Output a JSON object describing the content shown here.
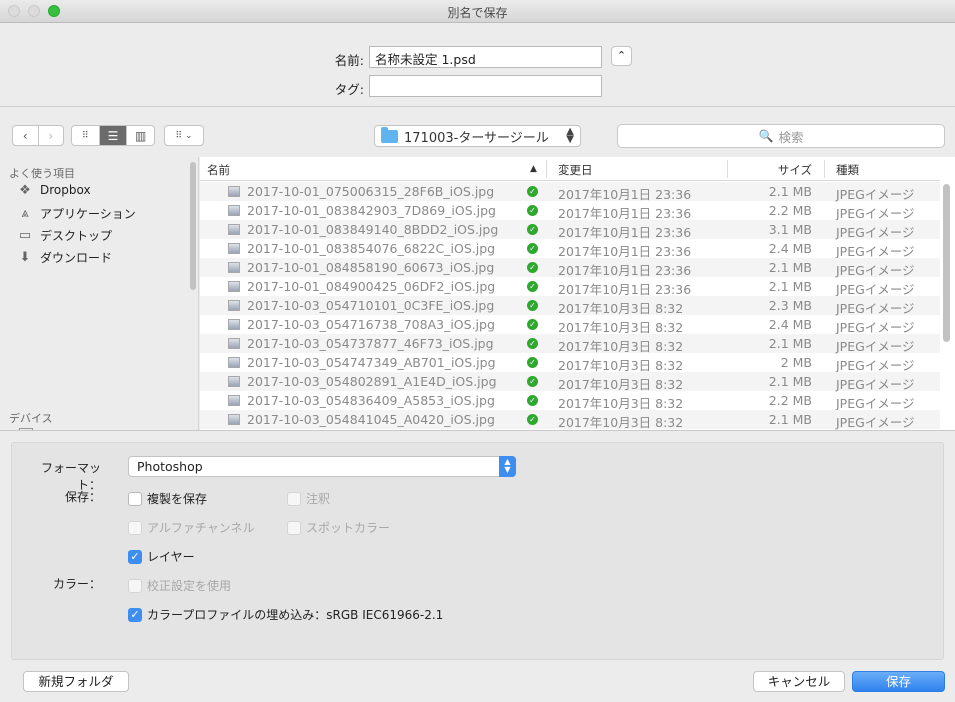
{
  "window": {
    "title": "別名で保存"
  },
  "name_field": {
    "label": "名前:",
    "value": "名称未設定 1.psd"
  },
  "tag_field": {
    "label": "タグ:",
    "value": ""
  },
  "toolbar": {
    "back_icon": "chevron-left-icon",
    "forward_icon": "chevron-right-icon",
    "location": "171003-ターサージール",
    "search_placeholder": "検索"
  },
  "sidebar": {
    "favorites_heading": "よく使う項目",
    "items": [
      {
        "label": "Dropbox",
        "icon": "dropbox-icon"
      },
      {
        "label": "アプリケーション",
        "icon": "applications-icon"
      },
      {
        "label": "デスクトップ",
        "icon": "desktop-icon"
      },
      {
        "label": "ダウンロード",
        "icon": "download-icon"
      }
    ],
    "devices_heading": "デバイス"
  },
  "file_list": {
    "columns": {
      "name": "名前",
      "modified": "変更日",
      "size": "サイズ",
      "kind": "種類"
    },
    "rows": [
      {
        "name": "2017-10-01_075006315_28F6B_iOS.jpg",
        "modified": "2017年10月1日 23:36",
        "size": "2.1 MB",
        "kind": "JPEGイメージ"
      },
      {
        "name": "2017-10-01_083842903_7D869_iOS.jpg",
        "modified": "2017年10月1日 23:36",
        "size": "2.2 MB",
        "kind": "JPEGイメージ"
      },
      {
        "name": "2017-10-01_083849140_8BDD2_iOS.jpg",
        "modified": "2017年10月1日 23:36",
        "size": "3.1 MB",
        "kind": "JPEGイメージ"
      },
      {
        "name": "2017-10-01_083854076_6822C_iOS.jpg",
        "modified": "2017年10月1日 23:36",
        "size": "2.4 MB",
        "kind": "JPEGイメージ"
      },
      {
        "name": "2017-10-01_084858190_60673_iOS.jpg",
        "modified": "2017年10月1日 23:36",
        "size": "2.1 MB",
        "kind": "JPEGイメージ"
      },
      {
        "name": "2017-10-01_084900425_06DF2_iOS.jpg",
        "modified": "2017年10月1日 23:36",
        "size": "2.1 MB",
        "kind": "JPEGイメージ"
      },
      {
        "name": "2017-10-03_054710101_0C3FE_iOS.jpg",
        "modified": "2017年10月3日 8:32",
        "size": "2.3 MB",
        "kind": "JPEGイメージ"
      },
      {
        "name": "2017-10-03_054716738_708A3_iOS.jpg",
        "modified": "2017年10月3日 8:32",
        "size": "2.4 MB",
        "kind": "JPEGイメージ"
      },
      {
        "name": "2017-10-03_054737877_46F73_iOS.jpg",
        "modified": "2017年10月3日 8:32",
        "size": "2.1 MB",
        "kind": "JPEGイメージ"
      },
      {
        "name": "2017-10-03_054747349_AB701_iOS.jpg",
        "modified": "2017年10月3日 8:32",
        "size": "2 MB",
        "kind": "JPEGイメージ"
      },
      {
        "name": "2017-10-03_054802891_A1E4D_iOS.jpg",
        "modified": "2017年10月3日 8:32",
        "size": "2.1 MB",
        "kind": "JPEGイメージ"
      },
      {
        "name": "2017-10-03_054836409_A5853_iOS.jpg",
        "modified": "2017年10月3日 8:32",
        "size": "2.2 MB",
        "kind": "JPEGイメージ"
      },
      {
        "name": "2017-10-03_054841045_A0420_iOS.jpg",
        "modified": "2017年10月3日 8:32",
        "size": "2.1 MB",
        "kind": "JPEGイメージ"
      }
    ]
  },
  "options": {
    "format_label": "フォーマット：",
    "format_value": "Photoshop",
    "save_label": "保存：",
    "color_label": "カラー：",
    "checkboxes": {
      "copy": {
        "label": "複製を保存",
        "checked": false,
        "disabled": false
      },
      "notes": {
        "label": "注釈",
        "checked": false,
        "disabled": true
      },
      "alpha": {
        "label": "アルファチャンネル",
        "checked": false,
        "disabled": true
      },
      "spot": {
        "label": "スポットカラー",
        "checked": false,
        "disabled": true
      },
      "layers": {
        "label": "レイヤー",
        "checked": true,
        "disabled": false
      },
      "proof": {
        "label": "校正設定を使用",
        "checked": false,
        "disabled": true
      },
      "icc": {
        "label": "カラープロファイルの埋め込み：sRGB IEC61966-2.1",
        "checked": true,
        "disabled": false
      }
    }
  },
  "buttons": {
    "new_folder": "新規フォルダ",
    "cancel": "キャンセル",
    "save": "保存"
  },
  "colors": {
    "accent": "#3d8ef0",
    "sync_check": "#2fa82f"
  }
}
